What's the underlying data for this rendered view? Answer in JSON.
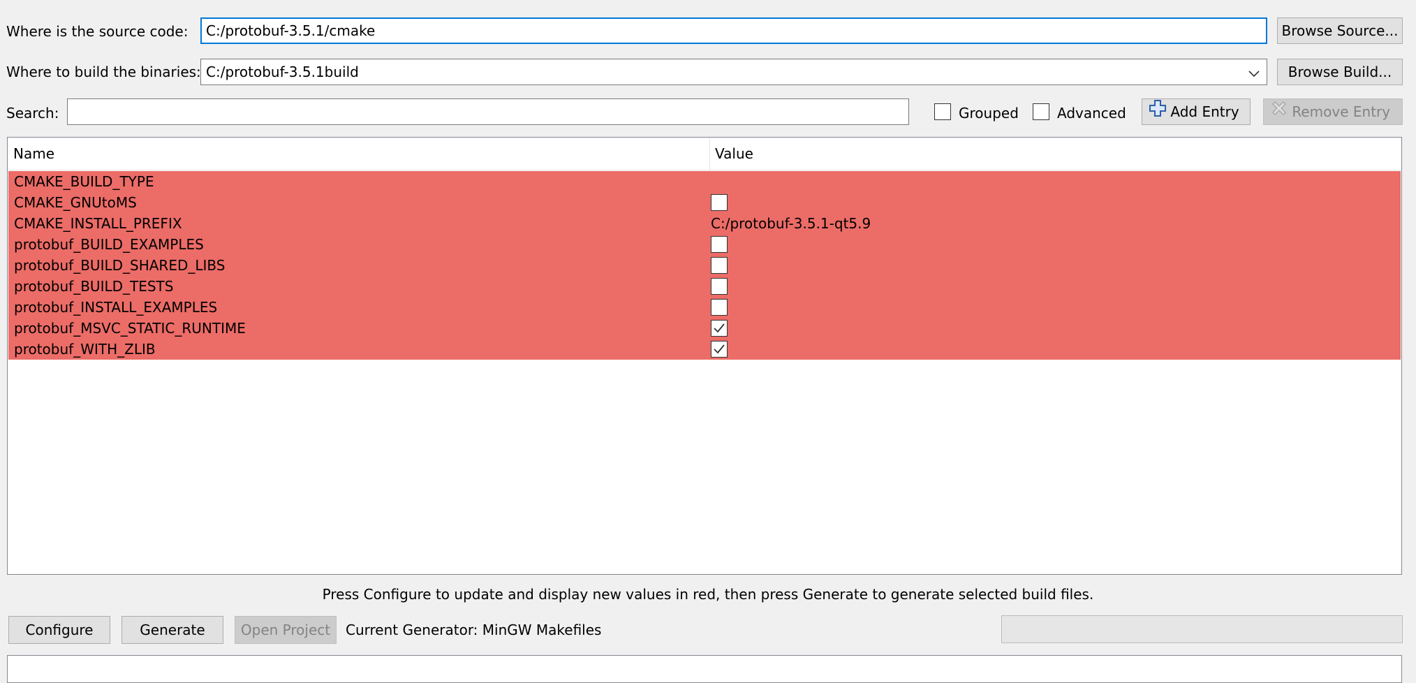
{
  "source": {
    "label": "Where is the source code:",
    "value": "C:/protobuf-3.5.1/cmake",
    "browse_label": "Browse Source..."
  },
  "build": {
    "label": "Where to build the binaries:",
    "value": "C:/protobuf-3.5.1build",
    "browse_label": "Browse Build..."
  },
  "search": {
    "label": "Search:",
    "value": ""
  },
  "options": {
    "grouped_label": "Grouped",
    "grouped_checked": false,
    "advanced_label": "Advanced",
    "advanced_checked": false,
    "add_entry_label": "Add Entry",
    "remove_entry_label": "Remove Entry"
  },
  "table": {
    "columns": [
      "Name",
      "Value"
    ],
    "rows": [
      {
        "name": "CMAKE_BUILD_TYPE",
        "type": "text",
        "value": ""
      },
      {
        "name": "CMAKE_GNUtoMS",
        "type": "bool",
        "value": false
      },
      {
        "name": "CMAKE_INSTALL_PREFIX",
        "type": "text",
        "value": "C:/protobuf-3.5.1-qt5.9"
      },
      {
        "name": "protobuf_BUILD_EXAMPLES",
        "type": "bool",
        "value": false
      },
      {
        "name": "protobuf_BUILD_SHARED_LIBS",
        "type": "bool",
        "value": false
      },
      {
        "name": "protobuf_BUILD_TESTS",
        "type": "bool",
        "value": false
      },
      {
        "name": "protobuf_INSTALL_EXAMPLES",
        "type": "bool",
        "value": false
      },
      {
        "name": "protobuf_MSVC_STATIC_RUNTIME",
        "type": "bool",
        "value": true
      },
      {
        "name": "protobuf_WITH_ZLIB",
        "type": "bool",
        "value": true
      }
    ],
    "new_row_color": "#ec6c67"
  },
  "hint": "Press Configure to update and display new values in red, then press Generate to generate selected build files.",
  "actions": {
    "configure_label": "Configure",
    "generate_label": "Generate",
    "open_project_label": "Open Project",
    "current_generator": "Current Generator: MinGW Makefiles"
  },
  "progress": 0
}
